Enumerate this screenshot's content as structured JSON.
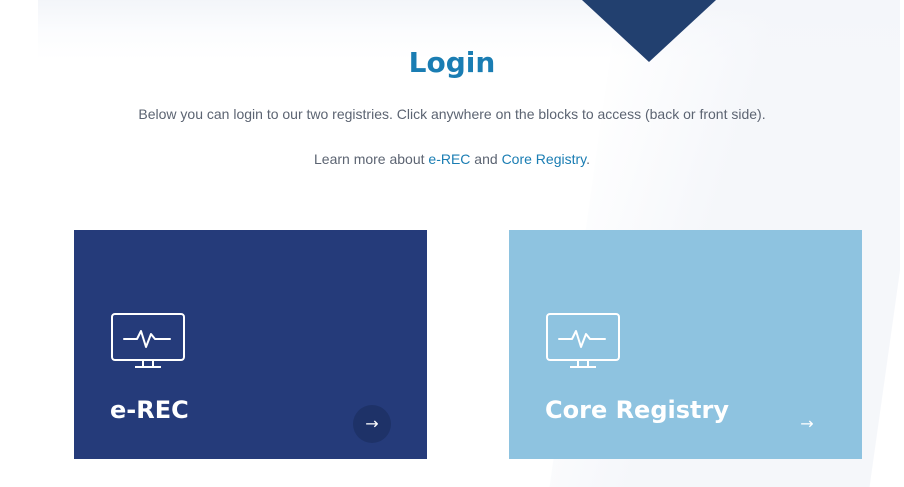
{
  "login": {
    "title": "Login",
    "intro": "Below you can login to our two registries. Click anywhere on the blocks to access (back or front side).",
    "learn_prefix": "Learn more about ",
    "learn_link_erec": "e-REC",
    "learn_and": " and ",
    "learn_link_core": "Core Registry",
    "learn_suffix": "."
  },
  "cards": [
    {
      "label": "e-REC",
      "icon": "monitor-heartbeat-icon",
      "arrow": "→",
      "color": "#253b7a"
    },
    {
      "label": "Core Registry",
      "icon": "monitor-heartbeat-icon",
      "arrow": "→",
      "color": "#8ec3e0"
    }
  ],
  "colors": {
    "accent": "#1a7db3",
    "notch": "#22406f",
    "text": "#5c6472"
  }
}
